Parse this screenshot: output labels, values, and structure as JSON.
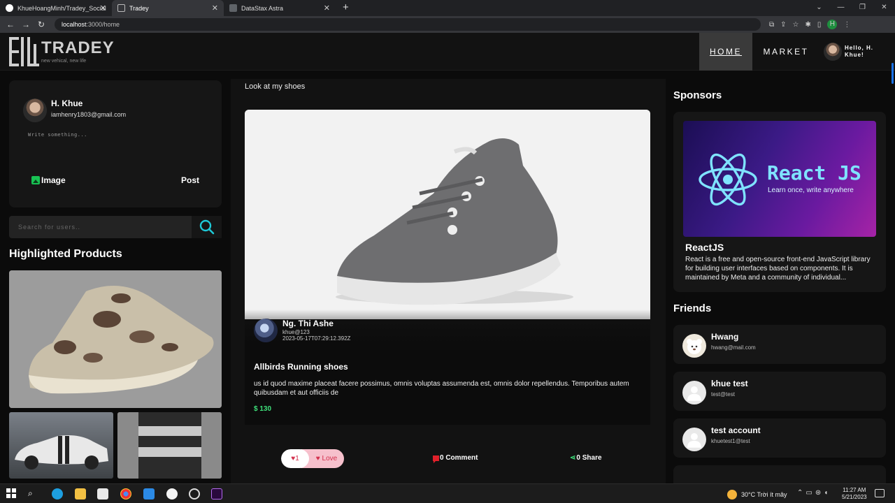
{
  "browser": {
    "tabs": [
      {
        "label": "KhueHoangMinh/Tradey_Social",
        "favicon_color": "#ffffff",
        "active": false
      },
      {
        "label": "Tradey",
        "favicon_color": "#9aa0a6",
        "active": true
      },
      {
        "label": "DataStax Astra",
        "favicon_color": "#5f6368",
        "active": false
      }
    ],
    "url_host": "localhost",
    "url_rest": ":3000/home",
    "profile_initial": "H"
  },
  "header": {
    "brand": "TRADEY",
    "tagline": "new vehical, new life",
    "nav_home": "HOME",
    "nav_market": "MARKET",
    "greeting": "Hello, H. Khue!"
  },
  "composer": {
    "name": "H. Khue",
    "email": "iamhenry1803@gmail.com",
    "placeholder": "Write something...",
    "image_label": "Image",
    "post_label": "Post"
  },
  "search": {
    "placeholder": "Search for users.."
  },
  "highlighted": {
    "title": "Highlighted Products"
  },
  "post": {
    "caption": "Look at my shoes",
    "author_name": "Ng. Thi Ashe",
    "author_handle": "khue@123",
    "timestamp": "2023-05-17T07:29:12.392Z",
    "product_title": "Allbirds Running shoes",
    "description": "us id quod maxime placeat facere possimus, omnis voluptas assumenda est, omnis dolor repellendus. Temporibus autem quibusdam et aut officiis de",
    "price": "$ 130",
    "like_count": "1",
    "love_label": "Love",
    "comment_label": "0 Comment",
    "share_label": "0 Share"
  },
  "sponsors": {
    "title": "Sponsors",
    "banner_title": "React JS",
    "banner_subtitle": "Learn once, write anywhere",
    "name": "ReactJS",
    "description": "React is a free and open-source front-end JavaScript library for building user interfaces based on components. It is maintained by Meta and a community of individual..."
  },
  "friends": {
    "title": "Friends",
    "items": [
      {
        "name": "Hwang",
        "email": "hwang@mail.com"
      },
      {
        "name": "khue test",
        "email": "test@test"
      },
      {
        "name": "test account",
        "email": "khuetest1@test"
      }
    ]
  },
  "taskbar": {
    "weather": "30°C  Trời ít mây",
    "time": "11:27 AM",
    "date": "5/21/2023"
  },
  "colors": {
    "accent_green": "#3ee07a",
    "love_red": "#d32f4c",
    "search_icon": "#1ec8d6"
  }
}
